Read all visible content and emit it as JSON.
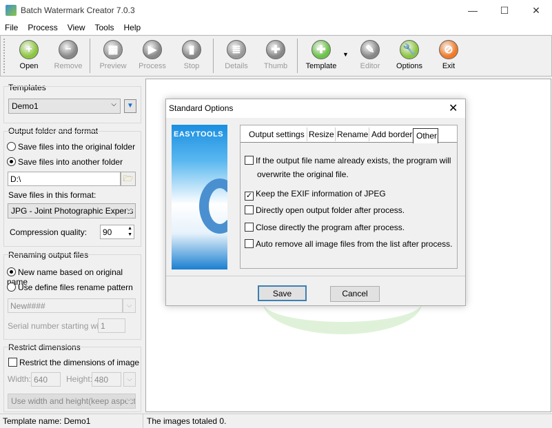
{
  "window": {
    "title": "Batch Watermark Creator 7.0.3",
    "minimize": "—",
    "maximize": "☐",
    "close": "✕"
  },
  "menu": [
    "File",
    "Process",
    "View",
    "Tools",
    "Help"
  ],
  "toolbar": [
    {
      "label": "Open",
      "icon": "plus-icon",
      "enabled": true,
      "color": "#8cc63f",
      "glyph": "+"
    },
    {
      "label": "Remove",
      "icon": "minus-icon",
      "enabled": false,
      "color": "#888888",
      "glyph": "−"
    },
    {
      "label": "Preview",
      "icon": "preview-icon",
      "enabled": false,
      "color": "#999999",
      "glyph": "▦"
    },
    {
      "label": "Process",
      "icon": "play-icon",
      "enabled": false,
      "color": "#888888",
      "glyph": "▶"
    },
    {
      "label": "Stop",
      "icon": "stop-icon",
      "enabled": false,
      "color": "#888888",
      "glyph": "▮"
    },
    {
      "label": "Details",
      "icon": "details-icon",
      "enabled": false,
      "color": "#999999",
      "glyph": "≣"
    },
    {
      "label": "Thumb",
      "icon": "thumb-icon",
      "enabled": false,
      "color": "#888888",
      "glyph": "✚"
    },
    {
      "label": "Template",
      "icon": "puzzle-icon",
      "enabled": true,
      "color": "#6cc24a",
      "glyph": "✚"
    },
    {
      "label": "Editor",
      "icon": "pencil-icon",
      "enabled": false,
      "color": "#888888",
      "glyph": "✎"
    },
    {
      "label": "Options",
      "icon": "wrench-icon",
      "enabled": true,
      "color": "#8cc63f",
      "glyph": "🔧"
    },
    {
      "label": "Exit",
      "icon": "exit-icon",
      "enabled": true,
      "color": "#f07a28",
      "glyph": "⊘"
    }
  ],
  "left": {
    "templates": {
      "title": "Templates",
      "value": "Demo1"
    },
    "output": {
      "title": "Output folder and format",
      "radio1": "Save files into the original folder",
      "radio2": "Save files into another folder",
      "folder": "D:\\",
      "format_label": "Save files in this format:",
      "format": "JPG - Joint Photographic Experts Group",
      "quality_label": "Compression quality:",
      "quality": "90"
    },
    "rename": {
      "title": "Renaming output files",
      "radio1": "New name based on original name",
      "radio2": "Use define files rename pattern",
      "pattern": "New####",
      "serial_label": "Serial number starting with",
      "serial": "1"
    },
    "restrict": {
      "title": "Restrict dimensions",
      "checkbox": "Restrict the dimensions of image",
      "width_label": "Width:",
      "width": "640",
      "height_label": "Height:",
      "height": "480",
      "mode": "Use width and height(keep aspect ratio)"
    }
  },
  "status": {
    "template": "Template name: Demo1",
    "images": "The images totaled 0."
  },
  "dialog": {
    "title": "Standard Options",
    "banner": "EASYTOOLS",
    "tabs": [
      "Output settings",
      "Resize",
      "Rename",
      "Add border",
      "Other"
    ],
    "options": [
      {
        "label": "If the output file name already exists, the program will",
        "label2": "overwrite the original file.",
        "checked": false
      },
      {
        "label": "Keep the EXIF information of JPEG",
        "checked": true
      },
      {
        "label": "Directly open output folder after process.",
        "checked": false
      },
      {
        "label": "Close directly the program after process.",
        "checked": false
      },
      {
        "label": "Auto remove all image files from the list after process.",
        "checked": false
      }
    ],
    "save": "Save",
    "cancel": "Cancel"
  }
}
